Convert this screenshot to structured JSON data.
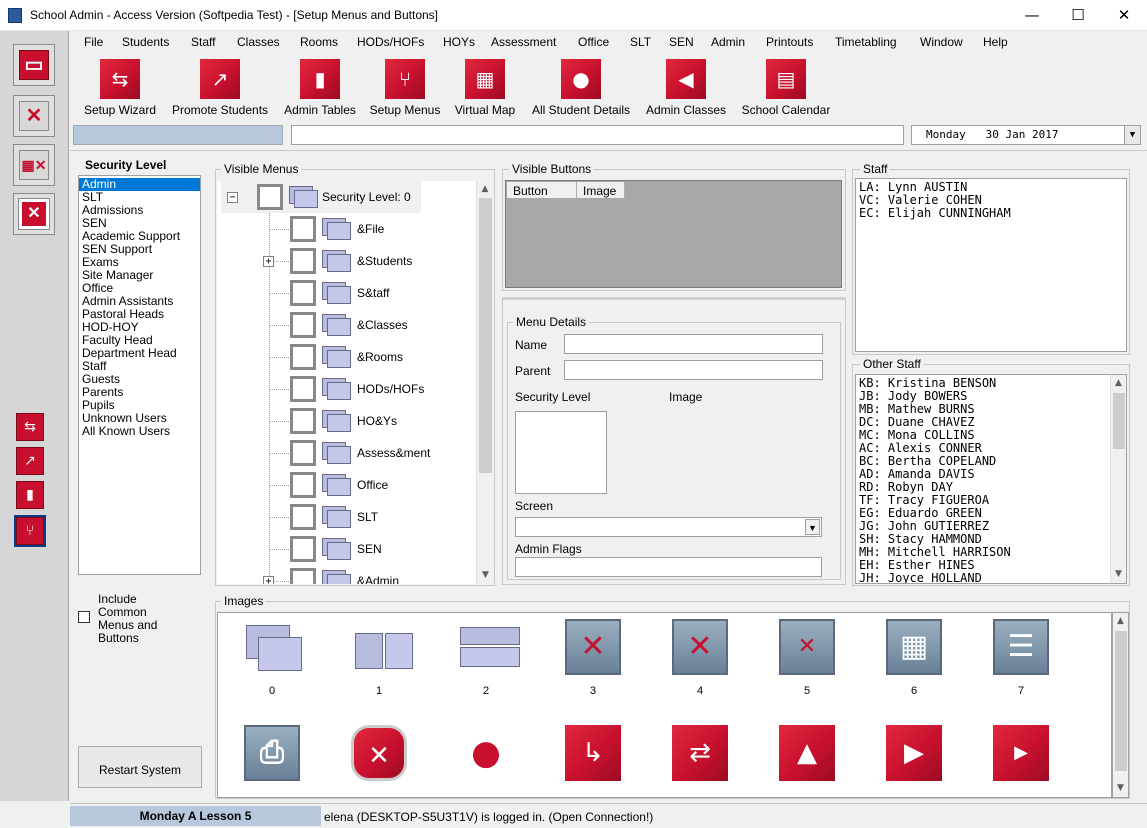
{
  "window": {
    "title": "School Admin - Access Version (Softpedia Test) - [Setup Menus and Buttons]",
    "minimize": "—",
    "maximize": "☐",
    "close": "✕"
  },
  "menu": [
    "File",
    "Students",
    "Staff",
    "Classes",
    "Rooms",
    "HODs/HOFs",
    "HOYs",
    "Assessment",
    "Office",
    "SLT",
    "SEN",
    "Admin",
    "Printouts",
    "Timetabling",
    "Window",
    "Help"
  ],
  "toolbar": [
    {
      "label": "Setup Wizard",
      "icon": "signpost-icon",
      "glyph": "⇆"
    },
    {
      "label": "Promote Students",
      "icon": "external-link-icon",
      "glyph": "↗"
    },
    {
      "label": "Admin Tables",
      "icon": "bar-chart-icon",
      "glyph": "▮"
    },
    {
      "label": "Setup Menus",
      "icon": "branch-icon",
      "glyph": "⑂"
    },
    {
      "label": "Virtual Map",
      "icon": "map-icon",
      "glyph": "▦"
    },
    {
      "label": "All Student Details",
      "icon": "person-icon",
      "glyph": "●"
    },
    {
      "label": "Admin Classes",
      "icon": "back-arrow-icon",
      "glyph": "◀"
    },
    {
      "label": "School Calendar",
      "icon": "calendar-icon",
      "glyph": "▤"
    }
  ],
  "date_field": {
    "day": "Monday",
    "date": "30 Jan 2017"
  },
  "security": {
    "heading": "Security Level",
    "levels": [
      "Admin",
      "SLT",
      "Admissions",
      "SEN",
      "Academic Support",
      "SEN Support",
      "Exams",
      "Site Manager",
      "Office",
      "Admin Assistants",
      "Pastoral Heads",
      "HOD-HOY",
      "Faculty Head",
      "Department Head",
      "Staff",
      "Guests",
      "Parents",
      "Pupils",
      "Unknown Users",
      "All Known Users"
    ],
    "selected": 0,
    "include_label": "Include Common Menus and Buttons",
    "restart_label": "Restart System"
  },
  "visible_menus": {
    "title": "Visible Menus",
    "root": "Security Level: 0",
    "items": [
      "&File",
      "&Students",
      "S&taff",
      "&Classes",
      "&Rooms",
      "HODs/HOFs",
      "HO&Ys",
      "Assess&ment",
      "Office",
      "SLT",
      "SEN",
      "&Admin"
    ]
  },
  "visible_buttons": {
    "title": "Visible Buttons",
    "col_button": "Button",
    "col_image": "Image"
  },
  "menu_details": {
    "title": "Menu Details",
    "name_label": "Name",
    "parent_label": "Parent",
    "security_label": "Security Level",
    "image_label": "Image",
    "screen_label": "Screen",
    "flags_label": "Admin Flags"
  },
  "staff": {
    "title": "Staff",
    "entries": [
      "LA: Lynn AUSTIN",
      "VC: Valerie COHEN",
      "EC: Elijah CUNNINGHAM"
    ]
  },
  "other_staff": {
    "title": "Other Staff",
    "entries": [
      "KB: Kristina BENSON",
      "JB: Jody BOWERS",
      "MB: Mathew BURNS",
      "DC: Duane CHAVEZ",
      "MC: Mona COLLINS",
      "AC: Alexis CONNER",
      "BC: Bertha COPELAND",
      "AD: Amanda DAVIS",
      "RD: Robyn DAY",
      "TF: Tracy FIGUEROA",
      "EG: Eduardo GREEN",
      "JG: John GUTIERREZ",
      "SH: Stacy HAMMOND",
      "MH: Mitchell HARRISON",
      "EH: Esther HINES",
      "JH: Joyce HOLLAND"
    ]
  },
  "images": {
    "title": "Images",
    "row1": [
      {
        "id": "0",
        "kind": "folders-stack-icon"
      },
      {
        "id": "1",
        "kind": "folders-side-icon"
      },
      {
        "id": "2",
        "kind": "folders-rows-icon"
      },
      {
        "id": "3",
        "kind": "x-icon"
      },
      {
        "id": "4",
        "kind": "multi-x-icon"
      },
      {
        "id": "5",
        "kind": "boxed-x-icon"
      },
      {
        "id": "6",
        "kind": "grid-icon"
      },
      {
        "id": "7",
        "kind": "lines-icon"
      }
    ],
    "row2": [
      {
        "kind": "printer-icon"
      },
      {
        "kind": "stop-icon"
      },
      {
        "kind": "pushpin-icon"
      },
      {
        "kind": "turn-arrow-icon"
      },
      {
        "kind": "swap-arrows-icon"
      },
      {
        "kind": "up-triangle-icon"
      },
      {
        "kind": "play-icon"
      },
      {
        "kind": "play-small-icon"
      }
    ]
  },
  "status": {
    "lesson": "Monday A Lesson 5",
    "message": "elena (DESKTOP-S5U3T1V) is logged in. (Open Connection!)"
  }
}
